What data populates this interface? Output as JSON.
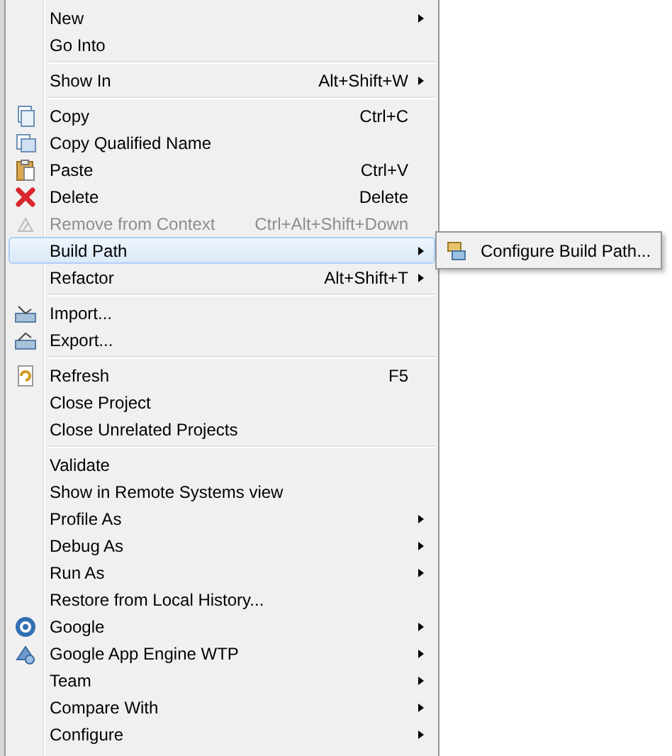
{
  "menu": {
    "entries": [
      {
        "kind": "item",
        "label": "New",
        "submenu": true,
        "disabled": false,
        "selected": false
      },
      {
        "kind": "item",
        "label": "Go Into",
        "submenu": false,
        "disabled": false,
        "selected": false
      },
      {
        "kind": "separator"
      },
      {
        "kind": "item",
        "label": "Show In",
        "shortcut": "Alt+Shift+W",
        "submenu": true,
        "disabled": false,
        "selected": false
      },
      {
        "kind": "separator"
      },
      {
        "kind": "item",
        "label": "Copy",
        "shortcut": "Ctrl+C",
        "submenu": false,
        "disabled": false,
        "selected": false
      },
      {
        "kind": "item",
        "label": "Copy Qualified Name",
        "submenu": false,
        "disabled": false,
        "selected": false
      },
      {
        "kind": "item",
        "label": "Paste",
        "shortcut": "Ctrl+V",
        "submenu": false,
        "disabled": false,
        "selected": false
      },
      {
        "kind": "item",
        "label": "Delete",
        "shortcut": "Delete",
        "submenu": false,
        "disabled": false,
        "selected": false
      },
      {
        "kind": "item",
        "label": "Remove from Context",
        "shortcut": "Ctrl+Alt+Shift+Down",
        "submenu": false,
        "disabled": true,
        "selected": false
      },
      {
        "kind": "item",
        "label": "Build Path",
        "submenu": true,
        "disabled": false,
        "selected": true
      },
      {
        "kind": "item",
        "label": "Refactor",
        "shortcut": "Alt+Shift+T",
        "submenu": true,
        "disabled": false,
        "selected": false
      },
      {
        "kind": "separator"
      },
      {
        "kind": "item",
        "label": "Import...",
        "submenu": false,
        "disabled": false,
        "selected": false
      },
      {
        "kind": "item",
        "label": "Export...",
        "submenu": false,
        "disabled": false,
        "selected": false
      },
      {
        "kind": "separator"
      },
      {
        "kind": "item",
        "label": "Refresh",
        "shortcut": "F5",
        "submenu": false,
        "disabled": false,
        "selected": false
      },
      {
        "kind": "item",
        "label": "Close Project",
        "submenu": false,
        "disabled": false,
        "selected": false
      },
      {
        "kind": "item",
        "label": "Close Unrelated Projects",
        "submenu": false,
        "disabled": false,
        "selected": false
      },
      {
        "kind": "separator"
      },
      {
        "kind": "item",
        "label": "Validate",
        "submenu": false,
        "disabled": false,
        "selected": false
      },
      {
        "kind": "item",
        "label": "Show in Remote Systems view",
        "submenu": false,
        "disabled": false,
        "selected": false
      },
      {
        "kind": "item",
        "label": "Profile As",
        "submenu": true,
        "disabled": false,
        "selected": false
      },
      {
        "kind": "item",
        "label": "Debug As",
        "submenu": true,
        "disabled": false,
        "selected": false
      },
      {
        "kind": "item",
        "label": "Run As",
        "submenu": true,
        "disabled": false,
        "selected": false
      },
      {
        "kind": "item",
        "label": "Restore from Local History...",
        "submenu": false,
        "disabled": false,
        "selected": false
      },
      {
        "kind": "item",
        "label": "Google",
        "submenu": true,
        "disabled": false,
        "selected": false
      },
      {
        "kind": "item",
        "label": "Google App Engine WTP",
        "submenu": true,
        "disabled": false,
        "selected": false
      },
      {
        "kind": "item",
        "label": "Team",
        "submenu": true,
        "disabled": false,
        "selected": false
      },
      {
        "kind": "item",
        "label": "Compare With",
        "submenu": true,
        "disabled": false,
        "selected": false
      },
      {
        "kind": "item",
        "label": "Configure",
        "submenu": true,
        "disabled": false,
        "selected": false
      }
    ]
  },
  "submenu": {
    "items": [
      {
        "label": "Configure Build Path...",
        "selected": false
      }
    ]
  }
}
